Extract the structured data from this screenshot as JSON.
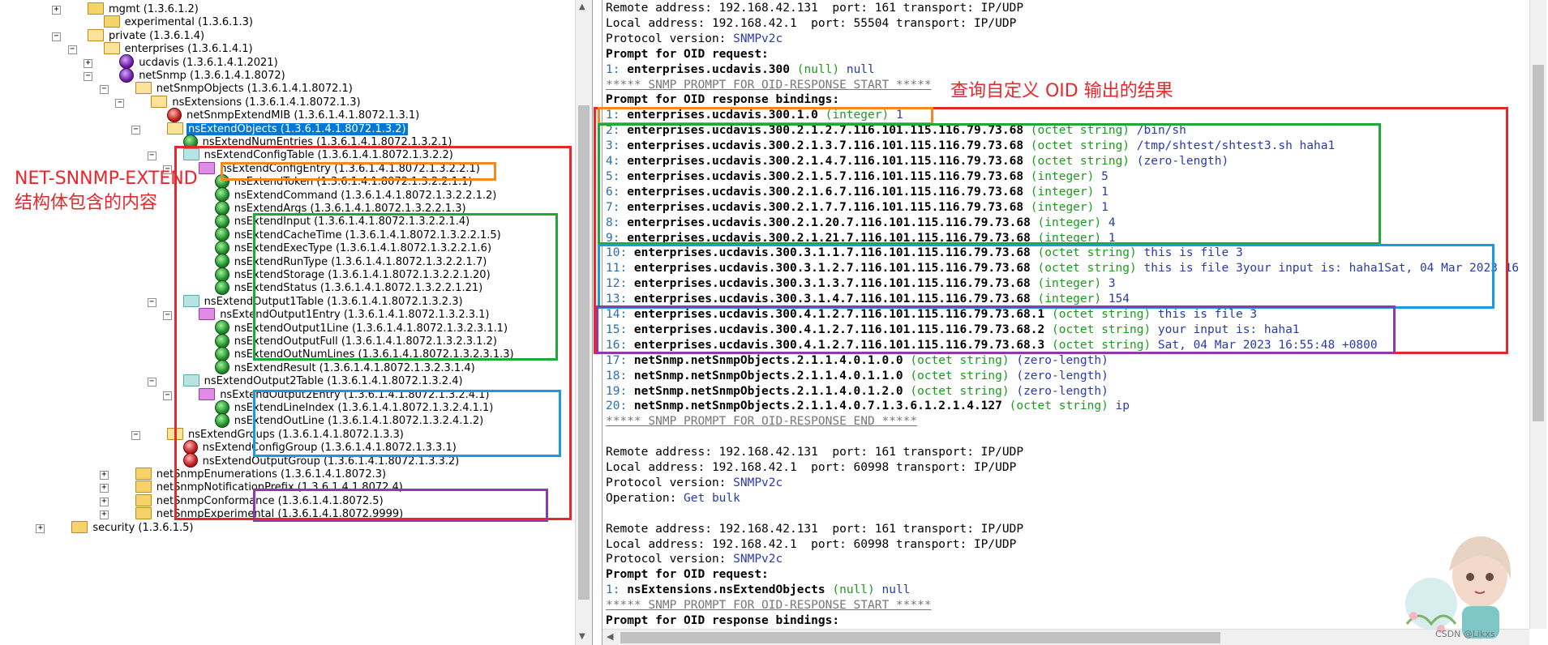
{
  "tree": {
    "rows": [
      {
        "label": "mgmt (1.3.6.1.2)",
        "icon": "folder",
        "expander": "+"
      },
      {
        "label": "experimental (1.3.6.1.3)",
        "icon": "folder",
        "expander": ""
      },
      {
        "label": "private (1.3.6.1.4)",
        "icon": "folder-open",
        "expander": "-"
      },
      {
        "label": "enterprises (1.3.6.1.4.1)",
        "icon": "folder-open",
        "expander": "-"
      },
      {
        "label": "ucdavis (1.3.6.1.4.1.2021)",
        "icon": "agent",
        "expander": "+"
      },
      {
        "label": "netSnmp (1.3.6.1.4.1.8072)",
        "icon": "agent",
        "expander": "-"
      },
      {
        "label": "netSnmpObjects (1.3.6.1.4.1.8072.1)",
        "icon": "folder-open",
        "expander": "-"
      },
      {
        "label": "nsExtensions (1.3.6.1.4.1.8072.1.3)",
        "icon": "folder-open",
        "expander": "-"
      },
      {
        "label": "netSnmpExtendMIB (1.3.6.1.4.1.8072.1.3.1)",
        "icon": "leaf-red",
        "expander": ""
      },
      {
        "label": "nsExtendObjects (1.3.6.1.4.1.8072.1.3.2)",
        "icon": "folder-open",
        "expander": "-",
        "selected": true
      },
      {
        "label": "nsExtendNumEntries (1.3.6.1.4.1.8072.1.3.2.1)",
        "icon": "leaf",
        "expander": ""
      },
      {
        "label": "nsExtendConfigTable (1.3.6.1.4.1.8072.1.3.2.2)",
        "icon": "folder-teal",
        "expander": "-"
      },
      {
        "label": "nsExtendConfigEntry (1.3.6.1.4.1.8072.1.3.2.2.1)",
        "icon": "folder-pink",
        "expander": "-"
      },
      {
        "label": "nsExtendToken (1.3.6.1.4.1.8072.1.3.2.2.1.1)",
        "icon": "leaf",
        "expander": ""
      },
      {
        "label": "nsExtendCommand (1.3.6.1.4.1.8072.1.3.2.2.1.2)",
        "icon": "leaf",
        "expander": ""
      },
      {
        "label": "nsExtendArgs (1.3.6.1.4.1.8072.1.3.2.2.1.3)",
        "icon": "leaf",
        "expander": ""
      },
      {
        "label": "nsExtendInput (1.3.6.1.4.1.8072.1.3.2.2.1.4)",
        "icon": "leaf",
        "expander": ""
      },
      {
        "label": "nsExtendCacheTime (1.3.6.1.4.1.8072.1.3.2.2.1.5)",
        "icon": "leaf",
        "expander": ""
      },
      {
        "label": "nsExtendExecType (1.3.6.1.4.1.8072.1.3.2.2.1.6)",
        "icon": "leaf",
        "expander": ""
      },
      {
        "label": "nsExtendRunType (1.3.6.1.4.1.8072.1.3.2.2.1.7)",
        "icon": "leaf",
        "expander": ""
      },
      {
        "label": "nsExtendStorage (1.3.6.1.4.1.8072.1.3.2.2.1.20)",
        "icon": "leaf",
        "expander": ""
      },
      {
        "label": "nsExtendStatus (1.3.6.1.4.1.8072.1.3.2.2.1.21)",
        "icon": "leaf",
        "expander": ""
      },
      {
        "label": "nsExtendOutput1Table (1.3.6.1.4.1.8072.1.3.2.3)",
        "icon": "folder-teal",
        "expander": "-"
      },
      {
        "label": "nsExtendOutput1Entry (1.3.6.1.4.1.8072.1.3.2.3.1)",
        "icon": "folder-pink",
        "expander": "-"
      },
      {
        "label": "nsExtendOutput1Line (1.3.6.1.4.1.8072.1.3.2.3.1.1)",
        "icon": "leaf",
        "expander": ""
      },
      {
        "label": "nsExtendOutputFull (1.3.6.1.4.1.8072.1.3.2.3.1.2)",
        "icon": "leaf",
        "expander": ""
      },
      {
        "label": "nsExtendOutNumLines (1.3.6.1.4.1.8072.1.3.2.3.1.3)",
        "icon": "leaf",
        "expander": ""
      },
      {
        "label": "nsExtendResult (1.3.6.1.4.1.8072.1.3.2.3.1.4)",
        "icon": "leaf",
        "expander": ""
      },
      {
        "label": "nsExtendOutput2Table (1.3.6.1.4.1.8072.1.3.2.4)",
        "icon": "folder-teal",
        "expander": "-"
      },
      {
        "label": "nsExtendOutput2Entry (1.3.6.1.4.1.8072.1.3.2.4.1)",
        "icon": "folder-pink",
        "expander": "-"
      },
      {
        "label": "nsExtendLineIndex (1.3.6.1.4.1.8072.1.3.2.4.1.1)",
        "icon": "leaf",
        "expander": ""
      },
      {
        "label": "nsExtendOutLine (1.3.6.1.4.1.8072.1.3.2.4.1.2)",
        "icon": "leaf",
        "expander": ""
      },
      {
        "label": "nsExtendGroups (1.3.6.1.4.1.8072.1.3.3)",
        "icon": "folder-open",
        "expander": "-"
      },
      {
        "label": "nsExtendConfigGroup (1.3.6.1.4.1.8072.1.3.3.1)",
        "icon": "leaf-red",
        "expander": ""
      },
      {
        "label": "nsExtendOutputGroup (1.3.6.1.4.1.8072.1.3.3.2)",
        "icon": "leaf-red",
        "expander": ""
      },
      {
        "label": "netSnmpEnumerations (1.3.6.1.4.1.8072.3)",
        "icon": "folder",
        "expander": "+"
      },
      {
        "label": "netSnmpNotificationPrefix (1.3.6.1.4.1.8072.4)",
        "icon": "folder",
        "expander": "+"
      },
      {
        "label": "netSnmpConformance (1.3.6.1.4.1.8072.5)",
        "icon": "folder",
        "expander": "+"
      },
      {
        "label": "netSnmpExperimental (1.3.6.1.4.1.8072.9999)",
        "icon": "folder",
        "expander": "+"
      },
      {
        "label": "security (1.3.6.1.5)",
        "icon": "folder",
        "expander": "+"
      }
    ]
  },
  "log": {
    "lines": [
      {
        "plain": "Remote address: 192.168.42.131  port: 161 transport: IP/UDP"
      },
      {
        "plain": "Local address: 192.168.42.1  port: 55504 transport: IP/UDP"
      },
      {
        "plain": "Protocol version: ",
        "value": "SNMPv2c"
      },
      {
        "bold": "Prompt for OID request:"
      },
      {
        "num": "1: ",
        "oid": "enterprises.ucdavis.300",
        "type": " (null)",
        "value": " null"
      },
      {
        "sep": "***** SNMP PROMPT FOR OID-RESPONSE START *****"
      },
      {
        "bold": "Prompt for OID response bindings:"
      },
      {
        "num": "1: ",
        "oid": "enterprises.ucdavis.300.1.0",
        "type": " (integer)",
        "value": " 1"
      },
      {
        "num": "2: ",
        "oid": "enterprises.ucdavis.300.2.1.2.7.116.101.115.116.79.73.68",
        "type": " (octet string)",
        "value": " /bin/sh"
      },
      {
        "num": "3: ",
        "oid": "enterprises.ucdavis.300.2.1.3.7.116.101.115.116.79.73.68",
        "type": " (octet string)",
        "value": " /tmp/shtest/shtest3.sh haha1"
      },
      {
        "num": "4: ",
        "oid": "enterprises.ucdavis.300.2.1.4.7.116.101.115.116.79.73.68",
        "type": " (octet string)",
        "value": " (zero-length)"
      },
      {
        "num": "5: ",
        "oid": "enterprises.ucdavis.300.2.1.5.7.116.101.115.116.79.73.68",
        "type": " (integer)",
        "value": " 5"
      },
      {
        "num": "6: ",
        "oid": "enterprises.ucdavis.300.2.1.6.7.116.101.115.116.79.73.68",
        "type": " (integer)",
        "value": " 1"
      },
      {
        "num": "7: ",
        "oid": "enterprises.ucdavis.300.2.1.7.7.116.101.115.116.79.73.68",
        "type": " (integer)",
        "value": " 1"
      },
      {
        "num": "8: ",
        "oid": "enterprises.ucdavis.300.2.1.20.7.116.101.115.116.79.73.68",
        "type": " (integer)",
        "value": " 4"
      },
      {
        "num": "9: ",
        "oid": "enterprises.ucdavis.300.2.1.21.7.116.101.115.116.79.73.68",
        "type": " (integer)",
        "value": " 1"
      },
      {
        "num": "10: ",
        "oid": "enterprises.ucdavis.300.3.1.1.7.116.101.115.116.79.73.68",
        "type": " (octet string)",
        "value": " this is file 3"
      },
      {
        "num": "11: ",
        "oid": "enterprises.ucdavis.300.3.1.2.7.116.101.115.116.79.73.68",
        "type": " (octet string)",
        "value": " this is file 3your input is: haha1Sat, 04 Mar 2023 16"
      },
      {
        "num": "12: ",
        "oid": "enterprises.ucdavis.300.3.1.3.7.116.101.115.116.79.73.68",
        "type": " (integer)",
        "value": " 3"
      },
      {
        "num": "13: ",
        "oid": "enterprises.ucdavis.300.3.1.4.7.116.101.115.116.79.73.68",
        "type": " (integer)",
        "value": " 154"
      },
      {
        "num": "14: ",
        "oid": "enterprises.ucdavis.300.4.1.2.7.116.101.115.116.79.73.68.1",
        "type": " (octet string)",
        "value": " this is file 3"
      },
      {
        "num": "15: ",
        "oid": "enterprises.ucdavis.300.4.1.2.7.116.101.115.116.79.73.68.2",
        "type": " (octet string)",
        "value": " your input is: haha1"
      },
      {
        "num": "16: ",
        "oid": "enterprises.ucdavis.300.4.1.2.7.116.101.115.116.79.73.68.3",
        "type": " (octet string)",
        "value": " Sat, 04 Mar 2023 16:55:48 +0800"
      },
      {
        "num": "17: ",
        "oid": "netSnmp.netSnmpObjects.2.1.1.4.0.1.0.0",
        "type": " (octet string)",
        "value": " (zero-length)"
      },
      {
        "num": "18: ",
        "oid": "netSnmp.netSnmpObjects.2.1.1.4.0.1.1.0",
        "type": " (octet string)",
        "value": " (zero-length)"
      },
      {
        "num": "19: ",
        "oid": "netSnmp.netSnmpObjects.2.1.1.4.0.1.2.0",
        "type": " (octet string)",
        "value": " (zero-length)"
      },
      {
        "num": "20: ",
        "oid": "netSnmp.netSnmpObjects.2.1.1.4.0.7.1.3.6.1.2.1.4.127",
        "type": " (octet string)",
        "value": " ip"
      },
      {
        "sep": "***** SNMP PROMPT FOR OID-RESPONSE END *****"
      },
      {
        "plain": ""
      },
      {
        "plain": "Remote address: 192.168.42.131  port: 161 transport: IP/UDP"
      },
      {
        "plain": "Local address: 192.168.42.1  port: 60998 transport: IP/UDP"
      },
      {
        "plain": "Protocol version: ",
        "value": "SNMPv2c"
      },
      {
        "plain": "Operation: ",
        "value": "Get bulk"
      },
      {
        "plain": ""
      },
      {
        "plain": "Remote address: 192.168.42.131  port: 161 transport: IP/UDP"
      },
      {
        "plain": "Local address: 192.168.42.1  port: 60998 transport: IP/UDP"
      },
      {
        "plain": "Protocol version: ",
        "value": "SNMPv2c"
      },
      {
        "bold": "Prompt for OID request:"
      },
      {
        "num": "1: ",
        "oid": "nsExtensions.nsExtendObjects",
        "type": " (null)",
        "value": " null"
      },
      {
        "sep": "***** SNMP PROMPT FOR OID-RESPONSE START *****"
      },
      {
        "bold": "Prompt for OID response bindings:"
      }
    ]
  },
  "annotations": {
    "left_line1": "NET-SNNMP-EXTEND",
    "left_line2": "结构体包含的内容",
    "right_title": "查询自定义 OID 输出的结果"
  },
  "watermark": "CSDN @Likxs",
  "colors": {
    "red": "#e8262d",
    "orange": "#f28a1e",
    "green": "#22a83a",
    "blue": "#1a9be0",
    "purple": "#8e3aa8",
    "selection": "#0078d7"
  }
}
